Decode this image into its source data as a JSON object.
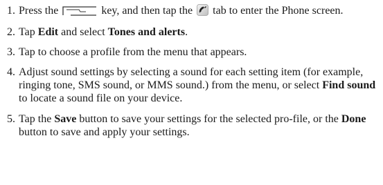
{
  "steps": [
    {
      "number": "1.",
      "text_a": "Press the",
      "key_icon": "home-key-icon",
      "text_b": "key, and then tap the",
      "tab_icon": "phone-handset-icon",
      "text_c": "tab to enter the Phone screen."
    },
    {
      "number": "2.",
      "text_a": "Tap ",
      "bold_a": "Edit",
      "text_b": " and select ",
      "bold_b": "Tones and alerts",
      "text_c": "."
    },
    {
      "number": "3.",
      "text_a": "Tap to choose a profile from the menu that appears."
    },
    {
      "number": "4.",
      "text_a": "Adjust sound settings by selecting a sound for each setting item (for example, ringing tone, SMS sound, or MMS sound.) from the menu, or select ",
      "bold_a": "Find sound",
      "text_b": " to locate a sound file on your device."
    },
    {
      "number": "5.",
      "text_a": "Tap the ",
      "bold_a": "Save",
      "text_b": " button to save your settings for the selected pro-file, or the ",
      "bold_b": "Done",
      "text_c": " button to save and apply your settings."
    }
  ]
}
